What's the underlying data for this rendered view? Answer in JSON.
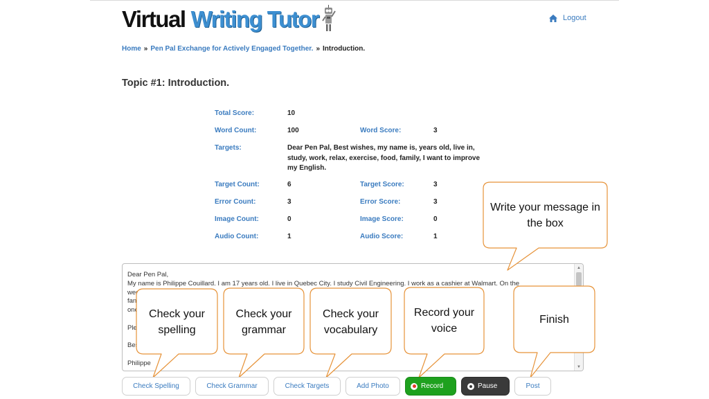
{
  "header": {
    "logo_virtual": "Virtual",
    "logo_rest": "Writing Tutor",
    "logout_label": "Logout"
  },
  "breadcrumb": {
    "home": "Home",
    "sep": "»",
    "group": "Pen Pal Exchange for Actively Engaged Together.",
    "current": "Introduction."
  },
  "title": "Topic #1: Introduction.",
  "scores": {
    "total_score": {
      "label": "Total Score:",
      "value": "10"
    },
    "word_count": {
      "label": "Word Count:",
      "value": "100"
    },
    "word_score": {
      "label": "Word Score:",
      "value": "3"
    },
    "targets": {
      "label": "Targets:",
      "value": "Dear Pen Pal, Best wishes, my name is, years old, live in, study, work, relax, exercise, food, family, I want to improve my English."
    },
    "target_count": {
      "label": "Target Count:",
      "value": "6"
    },
    "target_score": {
      "label": "Target Score:",
      "value": "3"
    },
    "error_count": {
      "label": "Error Count:",
      "value": "3"
    },
    "error_score": {
      "label": "Error Score:",
      "value": "3"
    },
    "image_count": {
      "label": "Image Count:",
      "value": "0"
    },
    "image_score": {
      "label": "Image Score:",
      "value": "0"
    },
    "audio_count": {
      "label": "Audio Count:",
      "value": "1"
    },
    "audio_score": {
      "label": "Audio Score:",
      "value": "1"
    }
  },
  "message": {
    "line1": "Dear Pen Pal,",
    "line2": "My name is Philippe Couillard. I am 17 years old. I live in Quebec City. I study Civil Engineering. I work as a cashier at Walmart. On the",
    "line3": "wee                                                        me                                 y c                                                         exerc                                             here are 4",
    "line4": "fan                                                        r a                                                              to                                             at I c                                                      sity one da",
    "line5": "Ple                                                     f.",
    "line6": "Bes",
    "line7": "Philippe"
  },
  "callouts": {
    "write_message": "Write your message in the box",
    "check_spelling": "Check your spelling",
    "check_grammar": "Check your grammar",
    "check_vocabulary": "Check your vocabulary",
    "record_voice": "Record your voice",
    "finish": "Finish"
  },
  "buttons": {
    "check_spelling": "Check Spelling",
    "check_grammar": "Check Grammar",
    "check_targets": "Check Targets",
    "add_photo": "Add Photo",
    "record": "Record",
    "pause": "Pause",
    "post": "Post"
  },
  "colors": {
    "link_blue": "#3a7bbf",
    "record_green": "#1ea11e",
    "pause_dark": "#3a3a3a",
    "callout_border": "#e69238"
  }
}
